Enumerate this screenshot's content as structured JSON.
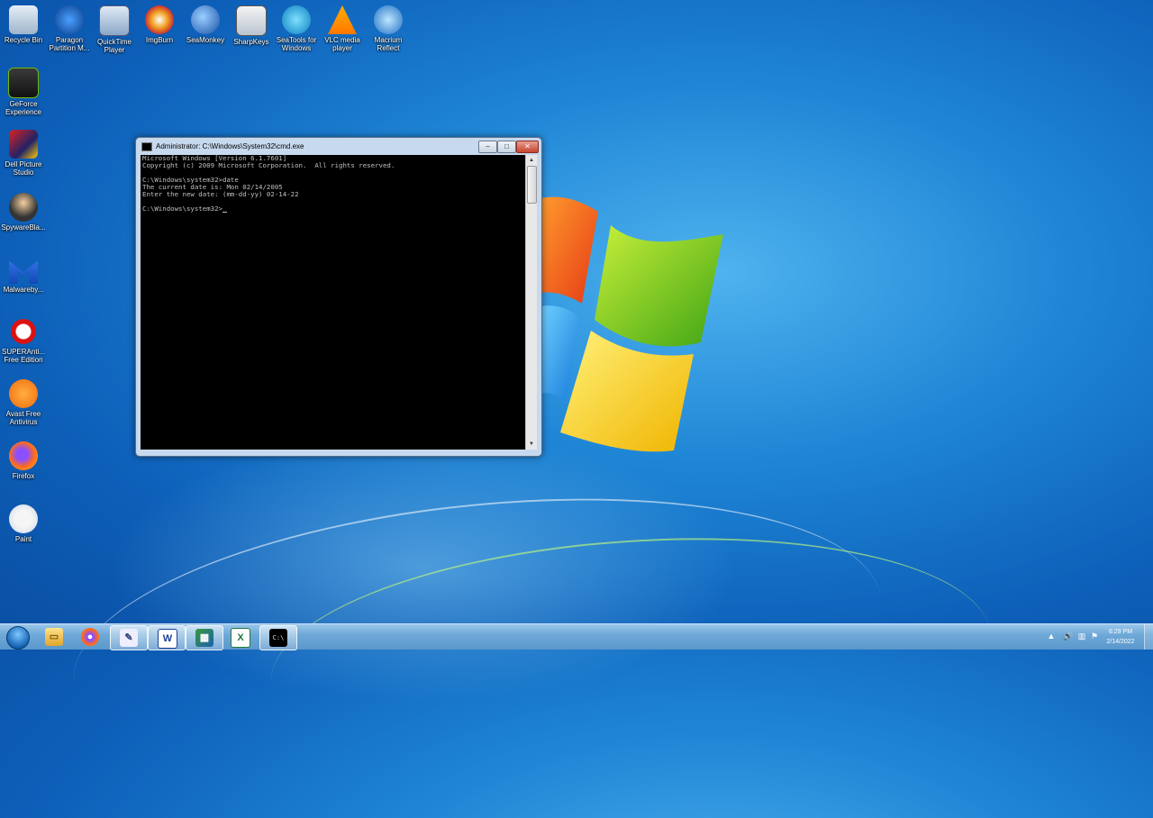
{
  "desktop": {
    "icons": [
      {
        "label": "Recycle Bin"
      },
      {
        "label": "Paragon Partition M..."
      },
      {
        "label": "QuickTime Player"
      },
      {
        "label": "ImgBurn"
      },
      {
        "label": "SeaMonkey"
      },
      {
        "label": "SharpKeys"
      },
      {
        "label": "SeaTools for Windows"
      },
      {
        "label": "VLC media player"
      },
      {
        "label": "Macrium Reflect"
      },
      {
        "label": "GeForce Experience"
      },
      {
        "label": "Dell Picture Studio"
      },
      {
        "label": "SpywareBla..."
      },
      {
        "label": "Malwareby..."
      },
      {
        "label": "SUPERAnti... Free Edition"
      },
      {
        "label": "Avast Free Antivirus"
      },
      {
        "label": "Firefox"
      },
      {
        "label": "Paint"
      }
    ]
  },
  "cmd": {
    "title": "Administrator: C:\\Windows\\System32\\cmd.exe",
    "min": "–",
    "max": "□",
    "close": "✕",
    "lines": [
      "Microsoft Windows [Version 6.1.7601]",
      "Copyright (c) 2009 Microsoft Corporation.  All rights reserved.",
      "",
      "C:\\Windows\\system32>date",
      "The current date is: Mon 02/14/2005",
      "Enter the new date: (mm-dd-yy) 02-14-22",
      "",
      "C:\\Windows\\system32>"
    ]
  },
  "taskbar": {
    "items": [
      {
        "name": "explorer",
        "glyph": "▭"
      },
      {
        "name": "firefox",
        "glyph": "●"
      },
      {
        "name": "paint",
        "glyph": "✎"
      },
      {
        "name": "word",
        "glyph": "W"
      },
      {
        "name": "control-panel",
        "glyph": "▦"
      },
      {
        "name": "excel",
        "glyph": "X"
      },
      {
        "name": "cmd",
        "glyph": "C:\\"
      }
    ],
    "tray": {
      "up_arrow": "▲",
      "volume": "🔊",
      "network": "▥",
      "flag": "⚑"
    },
    "clock": {
      "time": "6:29 PM",
      "date": "2/14/2022"
    }
  }
}
